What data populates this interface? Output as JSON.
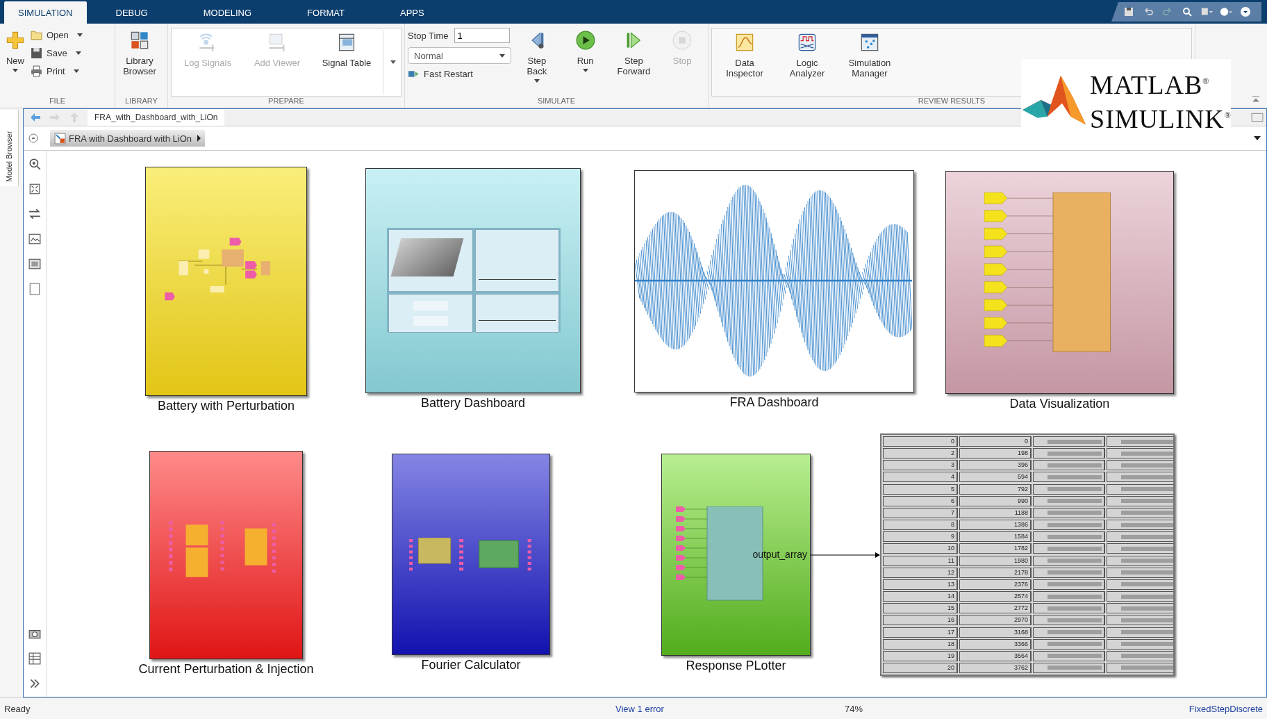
{
  "tabs": [
    {
      "label": "SIMULATION",
      "selected": true
    },
    {
      "label": "DEBUG",
      "selected": false
    },
    {
      "label": "MODELING",
      "selected": false
    },
    {
      "label": "FORMAT",
      "selected": false
    },
    {
      "label": "APPS",
      "selected": false
    }
  ],
  "toolstrip": {
    "file": {
      "title": "FILE",
      "new": "New",
      "items": [
        "Open",
        "Save",
        "Print"
      ]
    },
    "library": {
      "title": "LIBRARY",
      "button": "Library Browser"
    },
    "prepare": {
      "title": "PREPARE",
      "buttons": [
        {
          "label": "Log Signals",
          "disabled": true
        },
        {
          "label": "Add Viewer",
          "disabled": true
        },
        {
          "label": "Signal Table",
          "disabled": false
        }
      ]
    },
    "simulate": {
      "title": "SIMULATE",
      "stop_time_label": "Stop Time",
      "stop_time": "1",
      "mode": "Normal",
      "fast_restart": "Fast Restart",
      "buttons": [
        {
          "label": "Step Back",
          "disabled": false,
          "menu": true
        },
        {
          "label": "Run",
          "disabled": false,
          "menu": true
        },
        {
          "label": "Step Forward",
          "disabled": false,
          "menu": false
        },
        {
          "label": "Stop",
          "disabled": true,
          "menu": false
        }
      ]
    },
    "review": {
      "title": "REVIEW RESULTS",
      "buttons": [
        "Data Inspector",
        "Logic Analyzer",
        "Simulation Manager"
      ]
    }
  },
  "logo": {
    "top": "MATLAB$^{®}$",
    "bottom": "SIMULINK$^{®}$"
  },
  "model_browser": "Model Browser",
  "model_tab": "FRA_with_Dashboard_with_LiOn",
  "breadcrumb": "FRA with Dashboard with LiOn",
  "blocks": [
    {
      "kind": "battery",
      "label": "Battery with Perturbation"
    },
    {
      "kind": "dashboard",
      "label": "Battery Dashboard"
    },
    {
      "kind": "fra",
      "label": "FRA Dashboard"
    },
    {
      "kind": "datavis",
      "label": "Data Visualization"
    },
    {
      "kind": "current",
      "label": "Current Perturbation & Injection"
    },
    {
      "kind": "fourier",
      "label": "Fourier Calculator"
    },
    {
      "kind": "plotter",
      "label": "Response PLotter",
      "port": "output_array"
    }
  ],
  "display": {
    "rows": [
      [
        "0",
        "0"
      ],
      [
        "2",
        "198"
      ],
      [
        "3",
        "396"
      ],
      [
        "4",
        "594"
      ],
      [
        "5",
        "792"
      ],
      [
        "6",
        "990"
      ],
      [
        "7",
        "1188"
      ],
      [
        "8",
        "1386"
      ],
      [
        "9",
        "1584"
      ],
      [
        "10",
        "1782"
      ],
      [
        "11",
        "1980"
      ],
      [
        "12",
        "2178"
      ],
      [
        "13",
        "2376"
      ],
      [
        "14",
        "2574"
      ],
      [
        "15",
        "2772"
      ],
      [
        "16",
        "2970"
      ],
      [
        "17",
        "3168"
      ],
      [
        "18",
        "3366"
      ],
      [
        "19",
        "3564"
      ],
      [
        "20",
        "3762"
      ]
    ]
  },
  "status": {
    "left": "Ready",
    "center": "View 1 error",
    "zoom": "74%",
    "solver": "FixedStepDiscrete"
  }
}
